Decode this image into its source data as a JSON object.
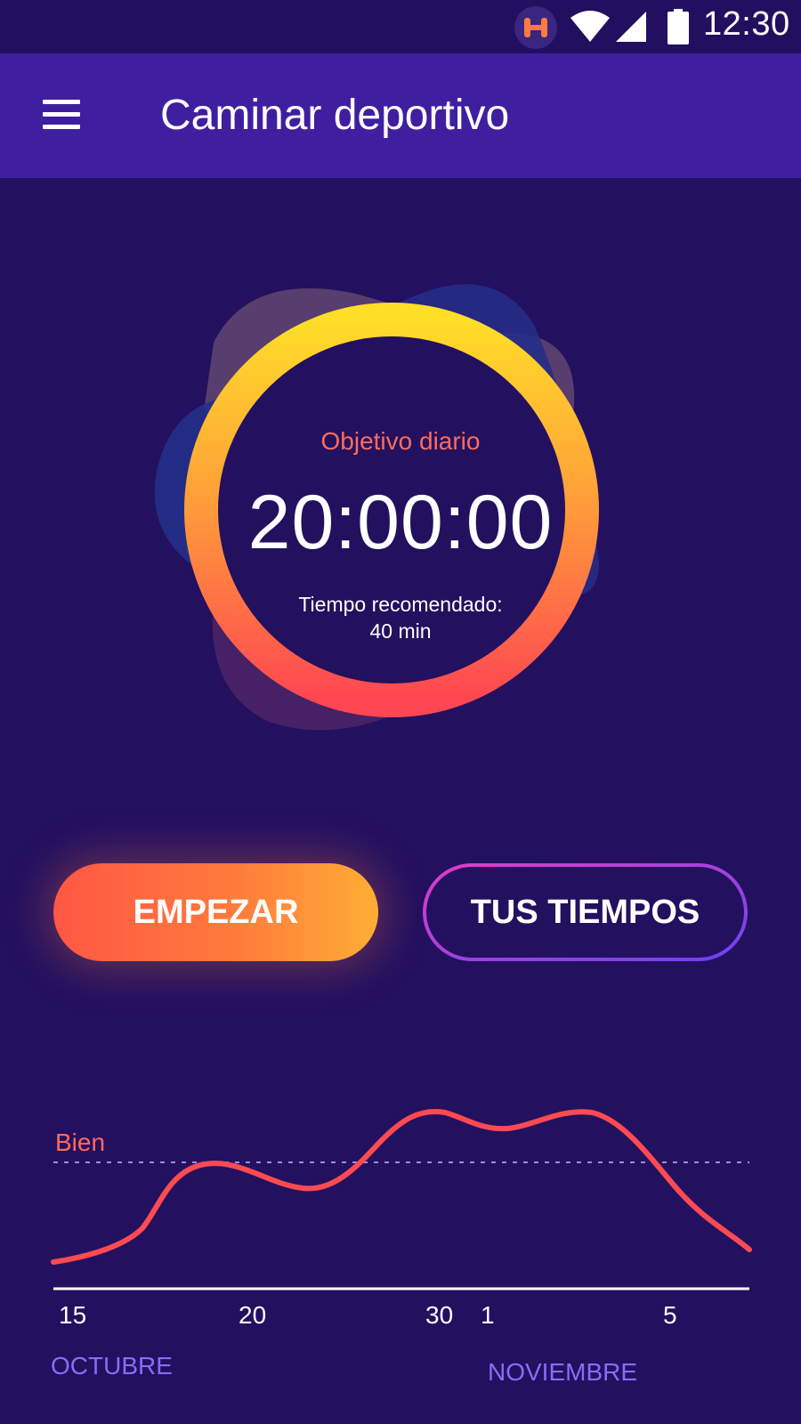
{
  "status_bar": {
    "time": "12:30",
    "icons": [
      "app-notification-icon",
      "wifi-icon",
      "cell-signal-icon",
      "battery-icon"
    ]
  },
  "toolbar": {
    "title": "Caminar deportivo",
    "menu_icon": "hamburger-menu-icon"
  },
  "goal": {
    "label": "Objetivo diario",
    "time": "20:00:00",
    "recommended_label": "Tiempo recomendado:",
    "recommended_value": "40 min"
  },
  "buttons": {
    "start": "EMPEZAR",
    "times": "TUS TIEMPOS"
  },
  "chart": {
    "reference_label": "Bien",
    "ticks": [
      "15",
      "20",
      "30",
      "1",
      "5"
    ],
    "months": [
      "OCTUBRE",
      "NOVIEMBRE"
    ]
  },
  "colors": {
    "background": "#23105f",
    "toolbar": "#3f1fa0",
    "accent_orange": "#ff6b5a",
    "accent_yellow": "#ffd52a",
    "month_purple": "#8a6cf5"
  }
}
